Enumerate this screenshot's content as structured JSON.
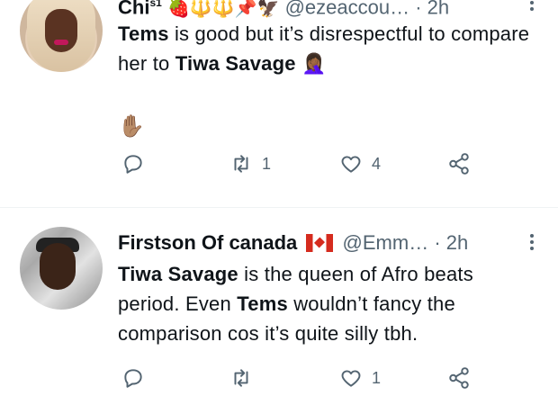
{
  "tweets": [
    {
      "name": "Chi",
      "superscript": "s1",
      "name_emojis": "🍓🔱🔱📌🦅",
      "handle": "@ezeaccou…",
      "dot": "·",
      "time": "2h",
      "text_parts": [
        {
          "bold": true,
          "text": "Tems"
        },
        {
          "bold": false,
          "text": " is good but it’s disrespectful to compare her to "
        },
        {
          "bold": true,
          "text": "Tiwa Savage"
        },
        {
          "bold": false,
          "text": " 🤦🏾‍♀️"
        }
      ],
      "extra_emoji": "✋🏽",
      "actions": {
        "reply": "",
        "retweet": "1",
        "like": "4",
        "share": ""
      }
    },
    {
      "name": "Firstson Of canada",
      "handle": "@Emm…",
      "dot": "·",
      "time": "2h",
      "text_parts": [
        {
          "bold": true,
          "text": "Tiwa Savage"
        },
        {
          "bold": false,
          "text": " is the queen of Afro beats period. Even "
        },
        {
          "bold": true,
          "text": "Tems"
        },
        {
          "bold": false,
          "text": " wouldn’t fancy the comparison cos it’s quite silly tbh."
        }
      ],
      "actions": {
        "reply": "",
        "retweet": "",
        "like": "1",
        "share": ""
      }
    }
  ],
  "icons": {
    "reply": "reply-icon",
    "retweet": "retweet-icon",
    "like": "heart-icon",
    "share": "share-icon",
    "more": "more-options-icon"
  },
  "colors": {
    "text": "#0f1419",
    "muted": "#536471",
    "divider": "#eff3f4"
  }
}
